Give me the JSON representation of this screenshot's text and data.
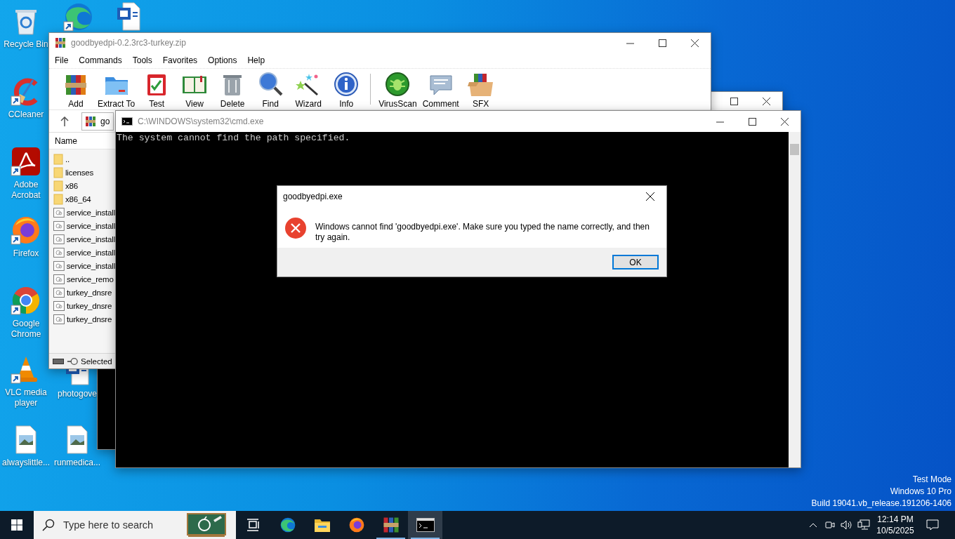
{
  "desktop": {
    "icons": [
      {
        "kind": "recycle-bin",
        "label": "Recycle Bin",
        "shortcut": false
      },
      {
        "kind": "edge",
        "shortcut": true
      },
      {
        "kind": "word",
        "shortcut": false
      },
      {
        "kind": "ccleaner",
        "label": "CCleaner",
        "shortcut": true
      },
      {
        "kind": "acrobat",
        "label": "Adobe Acrobat",
        "shortcut": true
      },
      {
        "kind": "firefox",
        "label": "Firefox",
        "shortcut": true
      },
      {
        "kind": "chrome",
        "label": "Google Chrome",
        "shortcut": true
      },
      {
        "kind": "vlc",
        "label": "VLC media player",
        "shortcut": true
      },
      {
        "kind": "word",
        "label": "photogove"
      },
      {
        "kind": "image-file",
        "label": "alwayslittle...",
        "shortcut": false
      },
      {
        "kind": "image-file",
        "label": "runmedica...",
        "shortcut": false
      }
    ],
    "system_info": [
      "Test Mode",
      "Windows 10 Pro",
      "Build 19041.vb_release.191206-1406"
    ]
  },
  "winrar": {
    "title": "goodbyedpi-0.2.3rc3-turkey.zip",
    "menu": [
      "File",
      "Commands",
      "Tools",
      "Favorites",
      "Options",
      "Help"
    ],
    "toolbar": [
      {
        "kind": "add",
        "label": "Add"
      },
      {
        "kind": "extract",
        "label": "Extract To"
      },
      {
        "kind": "test",
        "label": "Test"
      },
      {
        "kind": "view",
        "label": "View"
      },
      {
        "kind": "delete",
        "label": "Delete"
      },
      {
        "kind": "find",
        "label": "Find"
      },
      {
        "kind": "wizard",
        "label": "Wizard"
      },
      {
        "kind": "info",
        "label": "Info"
      },
      {
        "kind": "virusscan",
        "label": "VirusScan"
      },
      {
        "kind": "comment",
        "label": "Comment"
      },
      {
        "kind": "sfx",
        "label": "SFX"
      }
    ],
    "address": "go",
    "column": "Name",
    "rows": [
      {
        "kind": "folder",
        "name": ".."
      },
      {
        "kind": "folder",
        "name": "licenses"
      },
      {
        "kind": "folder",
        "name": "x86"
      },
      {
        "kind": "folder",
        "name": "x86_64"
      },
      {
        "kind": "file",
        "name": "service_install"
      },
      {
        "kind": "file",
        "name": "service_install"
      },
      {
        "kind": "file",
        "name": "service_install"
      },
      {
        "kind": "file",
        "name": "service_install"
      },
      {
        "kind": "file",
        "name": "service_install"
      },
      {
        "kind": "file",
        "name": "service_remo"
      },
      {
        "kind": "file",
        "name": "turkey_dnsre"
      },
      {
        "kind": "file",
        "name": "turkey_dnsre"
      },
      {
        "kind": "file",
        "name": "turkey_dnsre"
      }
    ],
    "status": "Selected"
  },
  "cmd": {
    "title": "C:\\WINDOWS\\system32\\cmd.exe",
    "lines": [
      "The system cannot find the path specified."
    ]
  },
  "dialog": {
    "title": "goodbyedpi.exe",
    "message": "Windows cannot find 'goodbyedpi.exe'. Make sure you typed the name correctly, and then try again.",
    "button": "OK"
  },
  "taskbar": {
    "search_placeholder": "Type here to search",
    "apps": [
      {
        "kind": "task-view",
        "running": false,
        "active": false
      },
      {
        "kind": "edge",
        "running": false,
        "active": false
      },
      {
        "kind": "explorer",
        "running": false,
        "active": false
      },
      {
        "kind": "firefox",
        "running": false,
        "active": false
      },
      {
        "kind": "winrar",
        "running": true,
        "active": false
      },
      {
        "kind": "cmd",
        "running": true,
        "active": true
      }
    ],
    "time": "12:14 PM",
    "date": "10/5/2025"
  }
}
